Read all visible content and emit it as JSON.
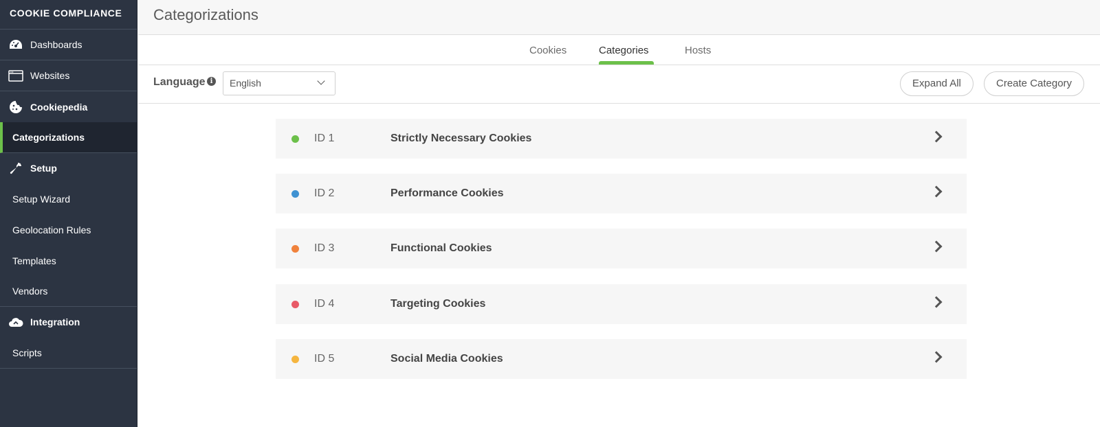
{
  "sidebar": {
    "brand": "Cookie Compliance",
    "items": [
      {
        "label": "Dashboards",
        "icon": "dashboard-icon"
      },
      {
        "label": "Websites",
        "icon": "browser-window-icon"
      },
      {
        "label": "Cookiepedia",
        "icon": "cookie-icon"
      },
      {
        "label": "Categorizations",
        "active": true
      },
      {
        "label": "Setup",
        "icon": "wrench-icon"
      },
      {
        "label": "Setup Wizard"
      },
      {
        "label": "Geolocation Rules"
      },
      {
        "label": "Templates"
      },
      {
        "label": "Vendors"
      },
      {
        "label": "Integration",
        "icon": "cloud-icon"
      },
      {
        "label": "Scripts"
      }
    ]
  },
  "header": {
    "title": "Categorizations"
  },
  "tabs": [
    {
      "label": "Cookies"
    },
    {
      "label": "Categories",
      "active": true
    },
    {
      "label": "Hosts"
    }
  ],
  "toolbar": {
    "language_label": "Language",
    "language_value": "English",
    "expand_all": "Expand All",
    "create_category": "Create Category"
  },
  "categories": [
    {
      "id": "ID 1",
      "name": "Strictly Necessary Cookies",
      "color": "#6cc04a"
    },
    {
      "id": "ID 2",
      "name": "Performance Cookies",
      "color": "#3f92d2"
    },
    {
      "id": "ID 3",
      "name": "Functional Cookies",
      "color": "#f0823c"
    },
    {
      "id": "ID 4",
      "name": "Targeting Cookies",
      "color": "#e85a67"
    },
    {
      "id": "ID 5",
      "name": "Social Media Cookies",
      "color": "#f5b53f"
    }
  ],
  "colors": {
    "accent": "#6cc04a",
    "sidebar_bg": "#2c3442"
  }
}
